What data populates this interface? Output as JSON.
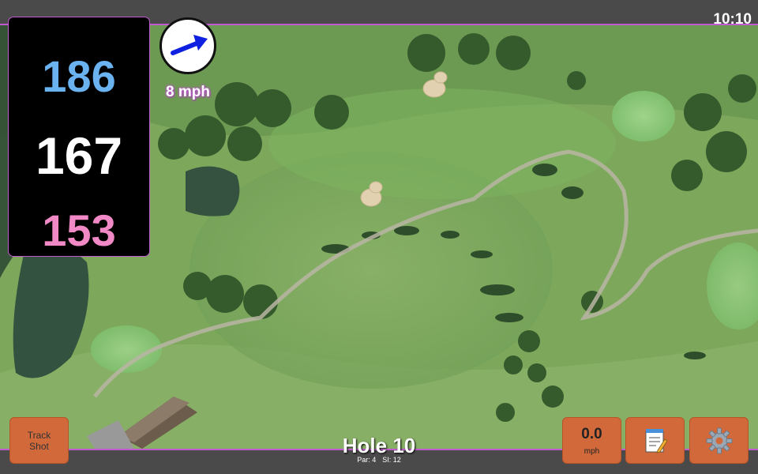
{
  "clock": "10:10",
  "distances": {
    "back": "186",
    "center": "167",
    "front": "153"
  },
  "wind": {
    "speed_label": "8 mph",
    "icon": "wind-arrow-icon"
  },
  "hole": {
    "title": "Hole 10",
    "par_label": "Par: 4",
    "si_label": "SI: 12"
  },
  "buttons": {
    "track_shot_line1": "Track",
    "track_shot_line2": "Shot",
    "speed_value": "0.0",
    "speed_unit": "mph",
    "notes_icon": "notepad-icon",
    "settings_icon": "gear-icon"
  },
  "colors": {
    "accent": "#c15ad0",
    "back_distance": "#6ab2f0",
    "center_distance": "#ffffff",
    "front_distance": "#f089c6",
    "button": "#d1693a"
  }
}
